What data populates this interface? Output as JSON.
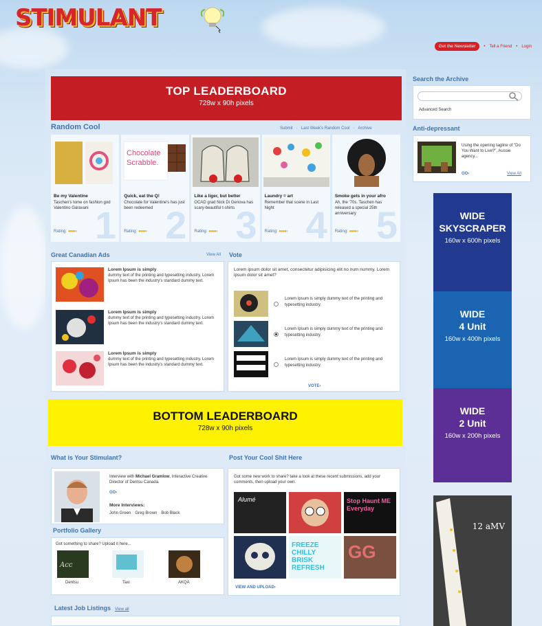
{
  "header": {
    "logo": "STIMULANT",
    "newsletter_button": "Get the Newsletter",
    "tell_friend": "Tell a Friend",
    "login": "Login"
  },
  "top_leaderboard": {
    "title": "TOP LEADERBOARD",
    "size": "728w x 90h pixels"
  },
  "random_cool": {
    "title": "Random Cool",
    "links": [
      "Submit",
      "Last Week's Random Cool",
      "Archive"
    ],
    "cards": [
      {
        "title": "Be my Valentine",
        "desc": "Taschen's tome on fashion god Valentino Garavani",
        "rating_label": "Rating:",
        "rating": 4,
        "num": "1"
      },
      {
        "title": "Quick, eat the Q!",
        "desc": "Chocolate for Valentine's has just been redeemed",
        "rating_label": "Rating:",
        "rating": 4,
        "num": "2",
        "img_text": "Chocolate Scrabble."
      },
      {
        "title": "Like a liger, but better",
        "desc": "OCAD grad Nick Di Genova has scary-beautiful t-shirts",
        "rating_label": "Rating:",
        "rating": 4,
        "num": "3"
      },
      {
        "title": "Laundry = art",
        "desc": "Remember that scene in Last Night",
        "rating_label": "Rating:",
        "rating": 4,
        "num": "4"
      },
      {
        "title": "Smoke gets in your afro",
        "desc": "Ah, the '70s. Taschen has released a special 25th anniversary",
        "rating_label": "Rating:",
        "rating": 4,
        "num": "5"
      }
    ]
  },
  "great_ads": {
    "title": "Great Canadian Ads",
    "view_all": "View All",
    "items": [
      {
        "title": "Lorem Ipsum is simply",
        "body": "dummy text of the printing and typesetting industry. Lorem Ipsum has been the industry's standard dummy text."
      },
      {
        "title": "Lorem Ipsum is simply",
        "body": "dummy text of the printing and typesetting industry. Lorem Ipsum has been the industry's standard dummy text."
      },
      {
        "title": "Lorem Ipsum is simply",
        "body": "dummy text of the printing and typesetting industry. Lorem Ipsum has been the industry's standard dummy text."
      }
    ]
  },
  "vote": {
    "title": "Vote",
    "question": "Lorem ipsum dolor sit amet, consectetur adipisicing elit no num nummy. Lorem ipsum dolor sit amet?",
    "options": [
      {
        "text": "Lorem Ipsum is simply dummy text of the printing and typesetting industry.",
        "selected": false
      },
      {
        "text": "Lorem Ipsum is simply dummy text of the printing and typesetting industry.",
        "selected": true
      },
      {
        "text": "Lorem Ipsum is simply dummy text of the printing and typesetting industry.",
        "selected": false
      }
    ],
    "submit": "VOTE›"
  },
  "bottom_leaderboard": {
    "title": "BOTTOM LEADERBOARD",
    "size": "728w x 90h pixels"
  },
  "stimulant": {
    "title": "What is Your Stimulant?",
    "interview_prefix": "Interview with ",
    "interview_name": "Michael Gramlow",
    "interview_suffix": ", Interactive Creative Director of Dentsu Canada.",
    "go": "GO›",
    "more_label": "More Interviews:",
    "more": [
      "John Green",
      "Greg Brown",
      "Bob Black"
    ]
  },
  "portfolio": {
    "title": "Portfolio Gallery",
    "prompt": "Got something to share? Upload it here...",
    "items": [
      "Dentsu",
      "Taxi",
      "AKQA"
    ]
  },
  "cool_shit": {
    "title": "Post Your Cool Shit Here",
    "intro": "Got some new work to share? take a look at these recent submissions, add your comments, then upload your own.",
    "tiles": [
      "Alumé",
      "",
      "Stop Haunt ME Everyday",
      "",
      "FREEZE CHILLY BRISK REFRESH",
      "GG"
    ],
    "view_upload": "VIEW AND UPLOAD›"
  },
  "jobs": {
    "title": "Latest Job Listings",
    "view_all": "View all"
  },
  "sidebar": {
    "search_title": "Search the Archive",
    "advanced": "Advanced Search",
    "anti_title": "Anti-depressant",
    "anti_text": "Using the opening tagline of \"Do You Want to Live?\", Aussie agency...",
    "anti_go": "GO›",
    "anti_view_all": "View All"
  },
  "ads": {
    "sky": {
      "l1": "WIDE",
      "l2": "SKYSCRAPER",
      "size": "160w x 600h pixels"
    },
    "four": {
      "l1": "WIDE",
      "l2": "4 Unit",
      "size": "160w x 400h pixels"
    },
    "two": {
      "l1": "WIDE",
      "l2": "2 Unit",
      "size": "160w x 200h pixels"
    },
    "amv": "12 aMV"
  },
  "colors": {
    "accent": "#3f74b0",
    "red": "#c41e24",
    "yellow": "#fff200",
    "navy": "#213a8f",
    "blue": "#1a64b2",
    "purple": "#5c2f96"
  }
}
